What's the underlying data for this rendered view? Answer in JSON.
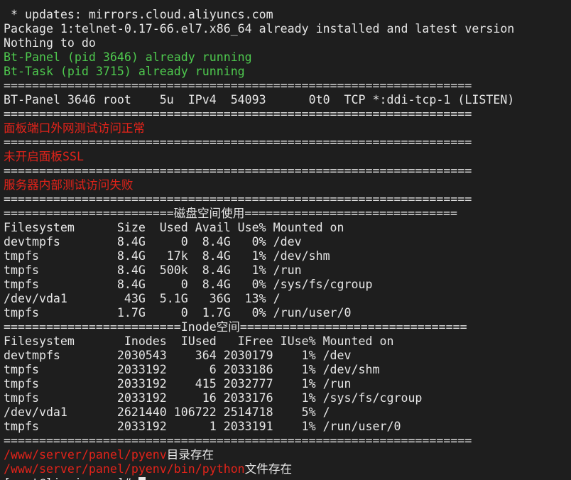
{
  "colors": {
    "background": "#1e1e1e",
    "text": "#e6e6e6",
    "green": "#4ec94e",
    "red": "#e2231a"
  },
  "lines": [
    {
      "segments": [
        {
          "text": " * updates: mirrors.cloud.aliyuncs.com",
          "color": "white"
        }
      ]
    },
    {
      "segments": [
        {
          "text": "Package 1:telnet-0.17-66.el7.x86_64 already installed and latest version",
          "color": "white"
        }
      ]
    },
    {
      "segments": [
        {
          "text": "Nothing to do",
          "color": "white"
        }
      ]
    },
    {
      "segments": [
        {
          "text": "Bt-Panel (pid 3646) already running",
          "color": "green"
        }
      ]
    },
    {
      "segments": [
        {
          "text": "Bt-Task (pid 3715) already running",
          "color": "green"
        }
      ]
    },
    {
      "segments": [
        {
          "text": "==================================================================",
          "color": "white"
        }
      ]
    },
    {
      "segments": [
        {
          "text": "BT-Panel 3646 root    5u  IPv4  54093      0t0  TCP *:ddi-tcp-1 (LISTEN)",
          "color": "white"
        }
      ]
    },
    {
      "segments": [
        {
          "text": "==================================================================",
          "color": "white"
        }
      ]
    },
    {
      "segments": [
        {
          "text": "面板端口外网测试访问正常",
          "color": "red"
        }
      ]
    },
    {
      "segments": [
        {
          "text": "==================================================================",
          "color": "white"
        }
      ]
    },
    {
      "segments": [
        {
          "text": "未开启面板SSL",
          "color": "red"
        }
      ]
    },
    {
      "segments": [
        {
          "text": "==================================================================",
          "color": "white"
        }
      ]
    },
    {
      "segments": [
        {
          "text": "服务器内部测试访问失败",
          "color": "red"
        }
      ]
    },
    {
      "segments": [
        {
          "text": "==================================================================",
          "color": "white"
        }
      ]
    },
    {
      "segments": [
        {
          "text": "========================磁盘空间使用==============================",
          "color": "white"
        }
      ]
    },
    {
      "segments": [
        {
          "text": "Filesystem      Size  Used Avail Use% Mounted on",
          "color": "white"
        }
      ]
    },
    {
      "segments": [
        {
          "text": "devtmpfs        8.4G     0  8.4G   0% /dev",
          "color": "white"
        }
      ]
    },
    {
      "segments": [
        {
          "text": "tmpfs           8.4G   17k  8.4G   1% /dev/shm",
          "color": "white"
        }
      ]
    },
    {
      "segments": [
        {
          "text": "tmpfs           8.4G  500k  8.4G   1% /run",
          "color": "white"
        }
      ]
    },
    {
      "segments": [
        {
          "text": "tmpfs           8.4G     0  8.4G   0% /sys/fs/cgroup",
          "color": "white"
        }
      ]
    },
    {
      "segments": [
        {
          "text": "/dev/vda1        43G  5.1G   36G  13% /",
          "color": "white"
        }
      ]
    },
    {
      "segments": [
        {
          "text": "tmpfs           1.7G     0  1.7G   0% /run/user/0",
          "color": "white"
        }
      ]
    },
    {
      "segments": [
        {
          "text": "=========================Inode空间================================",
          "color": "white"
        }
      ]
    },
    {
      "segments": [
        {
          "text": "Filesystem       Inodes  IUsed   IFree IUse% Mounted on",
          "color": "white"
        }
      ]
    },
    {
      "segments": [
        {
          "text": "devtmpfs        2030543    364 2030179    1% /dev",
          "color": "white"
        }
      ]
    },
    {
      "segments": [
        {
          "text": "tmpfs           2033192      6 2033186    1% /dev/shm",
          "color": "white"
        }
      ]
    },
    {
      "segments": [
        {
          "text": "tmpfs           2033192    415 2032777    1% /run",
          "color": "white"
        }
      ]
    },
    {
      "segments": [
        {
          "text": "tmpfs           2033192     16 2033176    1% /sys/fs/cgroup",
          "color": "white"
        }
      ]
    },
    {
      "segments": [
        {
          "text": "/dev/vda1       2621440 106722 2514718    5% /",
          "color": "white"
        }
      ]
    },
    {
      "segments": [
        {
          "text": "tmpfs           2033192      1 2033191    1% /run/user/0",
          "color": "white"
        }
      ]
    },
    {
      "segments": [
        {
          "text": "==================================================================",
          "color": "white"
        }
      ]
    },
    {
      "segments": [
        {
          "text": "/www/server/panel/pyenv",
          "color": "red"
        },
        {
          "text": "目录存在",
          "color": "white"
        }
      ]
    },
    {
      "segments": [
        {
          "text": "/www/server/panel/pyenv/bin/python",
          "color": "red"
        },
        {
          "text": "文件存在",
          "color": "white"
        }
      ]
    },
    {
      "segments": [
        {
          "text": "[root@lipeiyan ~]# ",
          "color": "white"
        }
      ],
      "cursor": true
    }
  ]
}
